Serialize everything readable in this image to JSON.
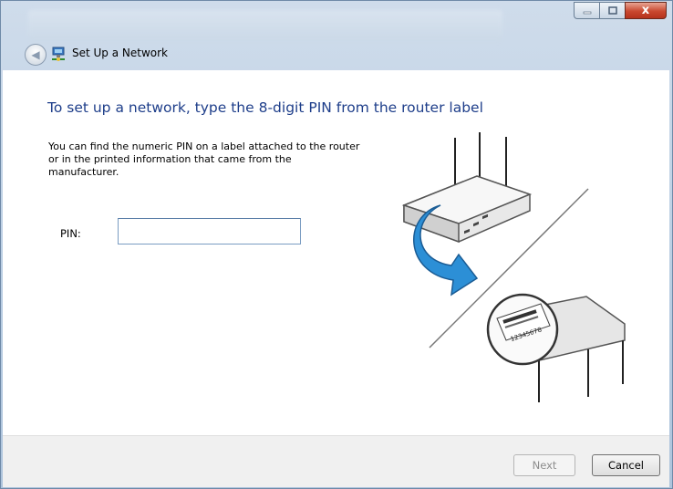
{
  "window": {
    "title": "Set Up a Network",
    "controls": {
      "minimize_icon": "minimize-icon",
      "maximize_icon": "maximize-icon",
      "close_symbol": "x"
    }
  },
  "nav": {
    "back_icon": "back-arrow-icon",
    "app_icon": "network-icon"
  },
  "main": {
    "heading": "To set up a network, type the 8-digit PIN from the router label",
    "description": "You can find the numeric PIN on a label attached to the router or in the printed information that came from the manufacturer.",
    "pin": {
      "label": "PIN:",
      "value": ""
    }
  },
  "illustration": {
    "label_number": "12345678",
    "icons": [
      "router-icon",
      "rotate-arrow-icon",
      "router-label-icon"
    ],
    "colors": {
      "arrow": "#2c8fd6"
    }
  },
  "footer": {
    "next_label": "Next",
    "cancel_label": "Cancel"
  },
  "colors": {
    "heading": "#1e3e8a",
    "chrome": "#b9cde2",
    "close_button": "#c9482f"
  }
}
